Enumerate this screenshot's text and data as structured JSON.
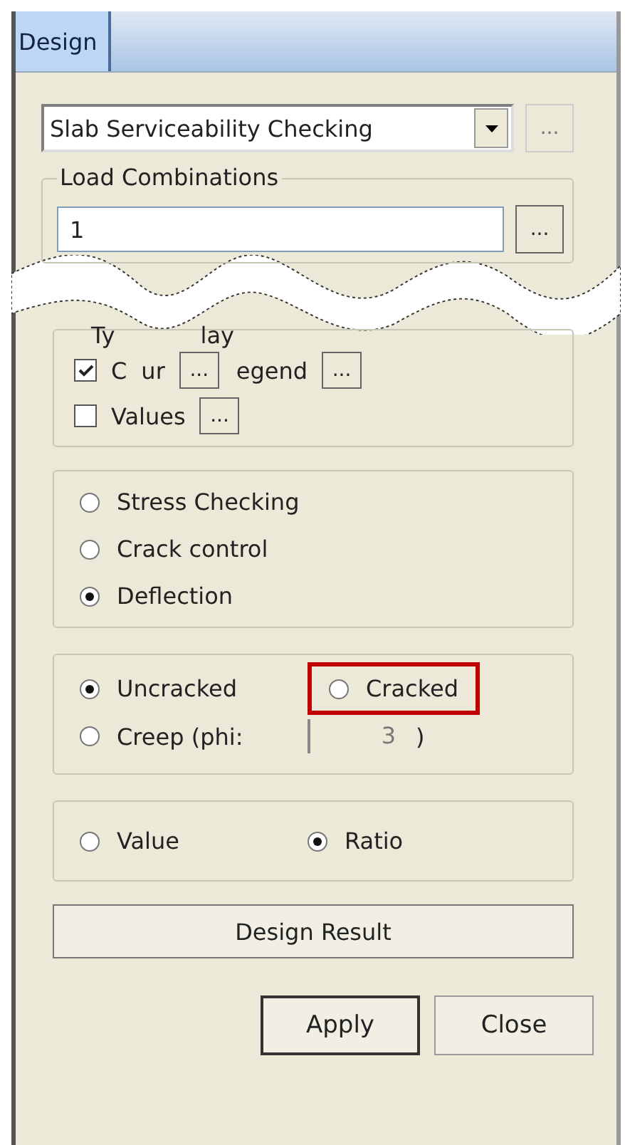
{
  "tabs": [
    {
      "label": "Design"
    }
  ],
  "analysis_dropdown": {
    "value": "Slab Serviceability Checking",
    "more_button": "..."
  },
  "load_combinations": {
    "title": "Load Combinations",
    "value": "1",
    "more_button": "..."
  },
  "display_group": {
    "title_parts": [
      "Ty",
      "lay"
    ],
    "items": [
      {
        "kind": "checkbox",
        "label_parts": [
          "C",
          "ur"
        ],
        "checked": true,
        "more_button": "..."
      },
      {
        "kind": "fragment",
        "label_parts": [
          "egend"
        ],
        "more_button": "..."
      },
      {
        "kind": "checkbox",
        "label_parts": [
          "Values"
        ],
        "checked": false,
        "more_button": "..."
      }
    ]
  },
  "check_type": [
    {
      "label": "Stress Checking",
      "selected": false
    },
    {
      "label": "Crack control",
      "selected": false
    },
    {
      "label": "Deflection",
      "selected": true
    }
  ],
  "section_state": {
    "options": [
      {
        "label": "Uncracked",
        "selected": true,
        "highlighted": false
      },
      {
        "label": "Cracked",
        "selected": false,
        "highlighted": true
      }
    ],
    "creep": {
      "label": "Creep (phi:",
      "selected": false,
      "value": "3",
      "close": ")"
    }
  },
  "output_mode": [
    {
      "label": "Value",
      "selected": false
    },
    {
      "label": "Ratio",
      "selected": true
    }
  ],
  "design_result_button": "Design Result",
  "buttons": [
    {
      "label": "Apply",
      "default": true
    },
    {
      "label": "Close",
      "default": false
    }
  ]
}
